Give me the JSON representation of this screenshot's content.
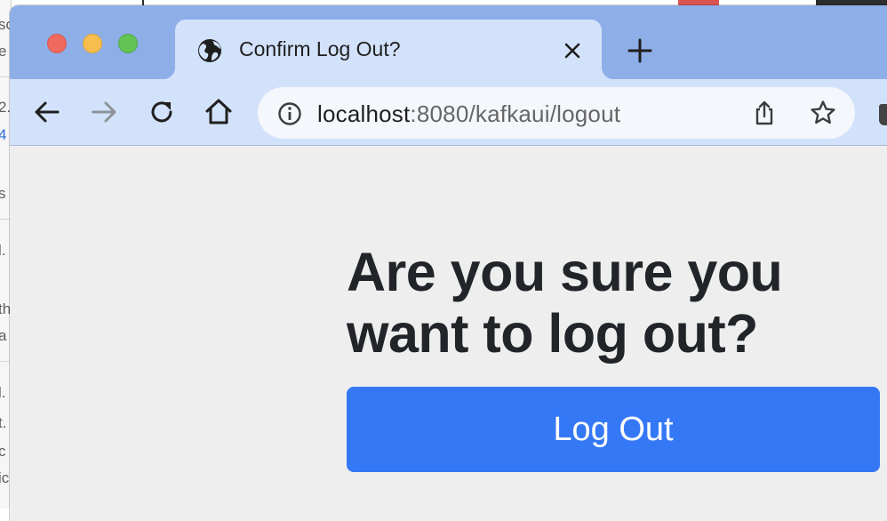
{
  "background_window": {
    "fragments": [
      "sc",
      "e",
      "2.",
      "4",
      "s",
      "l.",
      "th",
      "a",
      "l.",
      "t.",
      "c",
      "ic"
    ]
  },
  "browser": {
    "tab": {
      "title": "Confirm Log Out?",
      "favicon": "globe-icon"
    },
    "address_bar": {
      "host": "localhost",
      "path": ":8080/kafkaui/logout"
    }
  },
  "page": {
    "heading": "Are you sure you want to log out?",
    "logout_button_label": "Log Out"
  },
  "colors": {
    "primary_button": "#3478f6",
    "tab_strip": "#8eaee8",
    "active_tab": "#d3e2fb",
    "page_background": "#eeeeee",
    "heading_text": "#212529"
  }
}
